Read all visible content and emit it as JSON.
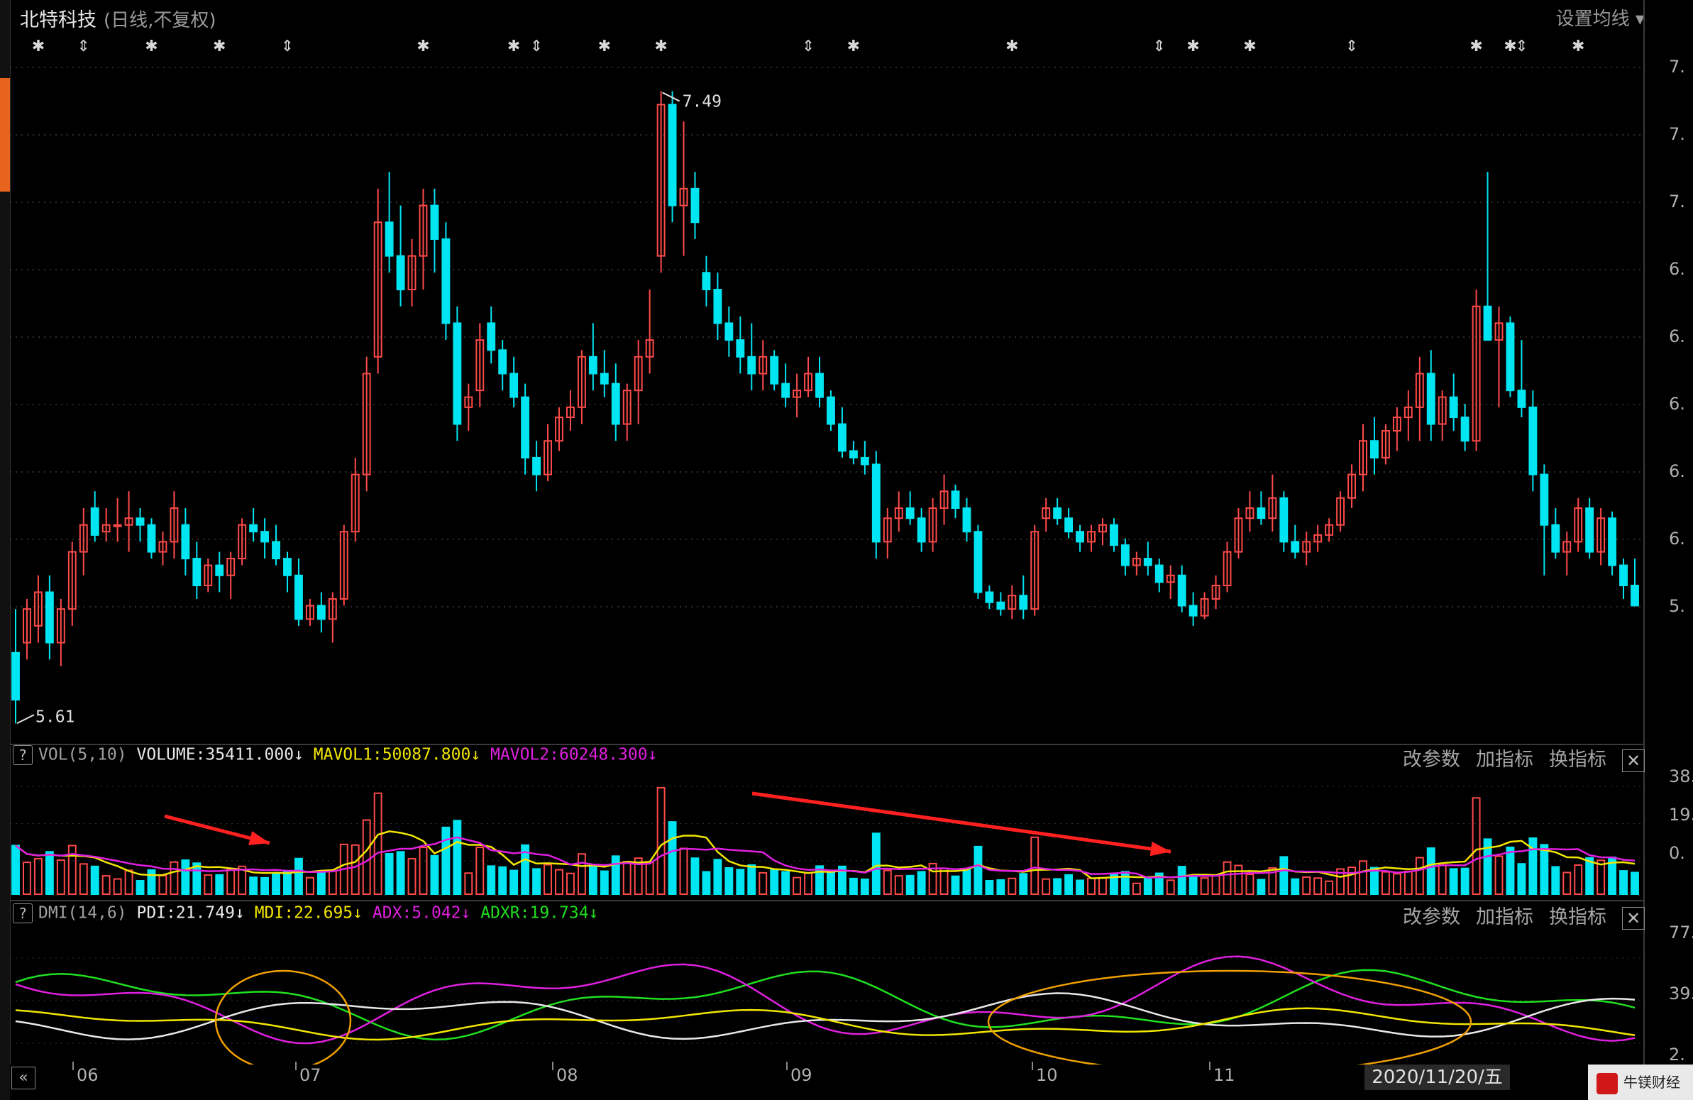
{
  "header": {
    "stock_name": "北特科技",
    "mode": "(日线,不复权)",
    "ma_settings_label": "设置均线 ▾"
  },
  "price_labels": {
    "high": "7.49",
    "low": "5.61"
  },
  "vol_panel": {
    "indicator": "VOL(5,10)",
    "volume_label": "VOLUME:35411.000",
    "mavol1_label": "MAVOL1:50087.800",
    "mavol2_label": "MAVOL2:60248.300",
    "arrow_down": "↓",
    "y_ticks": [
      "38.",
      "19.",
      "0."
    ]
  },
  "dmi_panel": {
    "indicator": "DMI(14,6)",
    "pdi_label": "PDI:21.749",
    "mdi_label": "MDI:22.695",
    "adx_label": "ADX:5.042",
    "adxr_label": "ADXR:19.734",
    "arrow_down": "↓",
    "y_ticks": [
      "77.",
      "39.",
      "2."
    ]
  },
  "panel_buttons": {
    "params": "改参数",
    "add": "加指标",
    "switch": "换指标",
    "close": "✕"
  },
  "price_axis_ticks": [
    "7.",
    "7.",
    "7.",
    "6.",
    "6.",
    "6.",
    "6.",
    "6.",
    "5."
  ],
  "x_axis": {
    "months": [
      "06",
      "07",
      "08",
      "09",
      "10",
      "11"
    ],
    "cursor_date": "2020/11/20/五"
  },
  "nav_button": "«",
  "logo_text": "牛镁财经",
  "colors": {
    "up": "#ff4a4a",
    "down": "#00e5f2",
    "white": "#e8e8e8",
    "yellow": "#f2e600",
    "magenta": "#e020e0",
    "green": "#20e020"
  },
  "chart_data": [
    {
      "type": "candlestick",
      "title": "北特科技",
      "x_months": [
        "06",
        "07",
        "08",
        "09",
        "10",
        "11"
      ],
      "ylim": [
        5.6,
        7.55
      ],
      "annotations": {
        "high": 7.49,
        "low": 5.61
      },
      "ohlc": [
        [
          5.82,
          5.95,
          5.61,
          5.68
        ],
        [
          5.85,
          5.98,
          5.8,
          5.95
        ],
        [
          5.9,
          6.05,
          5.85,
          6.0
        ],
        [
          6.0,
          6.05,
          5.8,
          5.85
        ],
        [
          5.85,
          5.98,
          5.78,
          5.95
        ],
        [
          5.95,
          6.15,
          5.9,
          6.12
        ],
        [
          6.12,
          6.25,
          6.05,
          6.2
        ],
        [
          6.25,
          6.3,
          6.15,
          6.17
        ],
        [
          6.18,
          6.25,
          6.15,
          6.2
        ],
        [
          6.2,
          6.28,
          6.15,
          6.2
        ],
        [
          6.2,
          6.3,
          6.12,
          6.22
        ],
        [
          6.22,
          6.25,
          6.15,
          6.2
        ],
        [
          6.2,
          6.22,
          6.1,
          6.12
        ],
        [
          6.12,
          6.18,
          6.08,
          6.15
        ],
        [
          6.15,
          6.3,
          6.1,
          6.25
        ],
        [
          6.2,
          6.25,
          6.05,
          6.1
        ],
        [
          6.1,
          6.15,
          5.98,
          6.02
        ],
        [
          6.02,
          6.1,
          6.0,
          6.08
        ],
        [
          6.08,
          6.12,
          6.0,
          6.05
        ],
        [
          6.05,
          6.12,
          5.98,
          6.1
        ],
        [
          6.1,
          6.22,
          6.08,
          6.2
        ],
        [
          6.2,
          6.25,
          6.15,
          6.18
        ],
        [
          6.18,
          6.22,
          6.1,
          6.15
        ],
        [
          6.15,
          6.2,
          6.08,
          6.1
        ],
        [
          6.1,
          6.12,
          6.0,
          6.05
        ],
        [
          6.05,
          6.1,
          5.9,
          5.92
        ],
        [
          5.92,
          5.98,
          5.9,
          5.96
        ],
        [
          5.96,
          6.0,
          5.88,
          5.92
        ],
        [
          5.92,
          6.0,
          5.85,
          5.98
        ],
        [
          5.98,
          6.2,
          5.96,
          6.18
        ],
        [
          6.18,
          6.4,
          6.15,
          6.35
        ],
        [
          6.35,
          6.7,
          6.3,
          6.65
        ],
        [
          6.7,
          7.2,
          6.65,
          7.1
        ],
        [
          7.1,
          7.25,
          6.95,
          7.0
        ],
        [
          7.0,
          7.15,
          6.85,
          6.9
        ],
        [
          6.9,
          7.05,
          6.85,
          7.0
        ],
        [
          7.0,
          7.2,
          6.9,
          7.15
        ],
        [
          7.15,
          7.2,
          6.95,
          7.05
        ],
        [
          7.05,
          7.1,
          6.75,
          6.8
        ],
        [
          6.8,
          6.85,
          6.45,
          6.5
        ],
        [
          6.55,
          6.62,
          6.48,
          6.58
        ],
        [
          6.6,
          6.8,
          6.55,
          6.75
        ],
        [
          6.8,
          6.85,
          6.68,
          6.72
        ],
        [
          6.72,
          6.75,
          6.6,
          6.65
        ],
        [
          6.65,
          6.7,
          6.55,
          6.58
        ],
        [
          6.58,
          6.62,
          6.35,
          6.4
        ],
        [
          6.4,
          6.45,
          6.3,
          6.35
        ],
        [
          6.35,
          6.5,
          6.33,
          6.45
        ],
        [
          6.45,
          6.55,
          6.42,
          6.52
        ],
        [
          6.52,
          6.6,
          6.48,
          6.55
        ],
        [
          6.55,
          6.72,
          6.5,
          6.7
        ],
        [
          6.7,
          6.8,
          6.6,
          6.65
        ],
        [
          6.65,
          6.72,
          6.58,
          6.62
        ],
        [
          6.62,
          6.68,
          6.45,
          6.5
        ],
        [
          6.5,
          6.62,
          6.45,
          6.6
        ],
        [
          6.6,
          6.75,
          6.5,
          6.7
        ],
        [
          6.7,
          6.9,
          6.65,
          6.75
        ],
        [
          7.0,
          7.49,
          6.95,
          7.45
        ],
        [
          7.45,
          7.49,
          7.1,
          7.15
        ],
        [
          7.15,
          7.4,
          7.0,
          7.2
        ],
        [
          7.2,
          7.25,
          7.05,
          7.1
        ],
        [
          6.95,
          7.0,
          6.85,
          6.9
        ],
        [
          6.9,
          6.95,
          6.75,
          6.8
        ],
        [
          6.8,
          6.85,
          6.7,
          6.75
        ],
        [
          6.75,
          6.82,
          6.65,
          6.7
        ],
        [
          6.7,
          6.8,
          6.6,
          6.65
        ],
        [
          6.65,
          6.75,
          6.6,
          6.7
        ],
        [
          6.7,
          6.72,
          6.6,
          6.62
        ],
        [
          6.62,
          6.68,
          6.55,
          6.58
        ],
        [
          6.58,
          6.65,
          6.52,
          6.6
        ],
        [
          6.6,
          6.7,
          6.58,
          6.65
        ],
        [
          6.65,
          6.7,
          6.55,
          6.58
        ],
        [
          6.58,
          6.6,
          6.48,
          6.5
        ],
        [
          6.5,
          6.55,
          6.4,
          6.42
        ],
        [
          6.42,
          6.45,
          6.38,
          6.4
        ],
        [
          6.4,
          6.45,
          6.35,
          6.38
        ],
        [
          6.38,
          6.42,
          6.1,
          6.15
        ],
        [
          6.15,
          6.25,
          6.1,
          6.22
        ],
        [
          6.22,
          6.3,
          6.18,
          6.25
        ],
        [
          6.25,
          6.3,
          6.2,
          6.22
        ],
        [
          6.22,
          6.25,
          6.12,
          6.15
        ],
        [
          6.15,
          6.28,
          6.12,
          6.25
        ],
        [
          6.25,
          6.35,
          6.2,
          6.3
        ],
        [
          6.3,
          6.32,
          6.22,
          6.25
        ],
        [
          6.25,
          6.28,
          6.15,
          6.18
        ],
        [
          6.18,
          6.2,
          5.98,
          6.0
        ],
        [
          6.0,
          6.02,
          5.95,
          5.97
        ],
        [
          5.97,
          6.0,
          5.93,
          5.95
        ],
        [
          5.95,
          6.02,
          5.92,
          5.99
        ],
        [
          5.99,
          6.05,
          5.92,
          5.95
        ],
        [
          5.95,
          6.2,
          5.93,
          6.18
        ],
        [
          6.22,
          6.28,
          6.18,
          6.25
        ],
        [
          6.25,
          6.28,
          6.2,
          6.22
        ],
        [
          6.22,
          6.25,
          6.16,
          6.18
        ],
        [
          6.18,
          6.2,
          6.12,
          6.15
        ],
        [
          6.15,
          6.2,
          6.12,
          6.18
        ],
        [
          6.18,
          6.22,
          6.14,
          6.2
        ],
        [
          6.2,
          6.22,
          6.12,
          6.14
        ],
        [
          6.14,
          6.16,
          6.05,
          6.08
        ],
        [
          6.08,
          6.12,
          6.05,
          6.1
        ],
        [
          6.1,
          6.15,
          6.05,
          6.08
        ],
        [
          6.08,
          6.1,
          6.0,
          6.03
        ],
        [
          6.03,
          6.08,
          5.98,
          6.05
        ],
        [
          6.05,
          6.08,
          5.94,
          5.96
        ],
        [
          5.96,
          6.0,
          5.9,
          5.93
        ],
        [
          5.93,
          6.0,
          5.92,
          5.98
        ],
        [
          5.98,
          6.05,
          5.95,
          6.02
        ],
        [
          6.02,
          6.15,
          6.0,
          6.12
        ],
        [
          6.12,
          6.25,
          6.1,
          6.22
        ],
        [
          6.22,
          6.3,
          6.18,
          6.25
        ],
        [
          6.25,
          6.3,
          6.2,
          6.22
        ],
        [
          6.22,
          6.35,
          6.18,
          6.28
        ],
        [
          6.28,
          6.3,
          6.12,
          6.15
        ],
        [
          6.15,
          6.2,
          6.1,
          6.12
        ],
        [
          6.12,
          6.18,
          6.08,
          6.15
        ],
        [
          6.15,
          6.2,
          6.12,
          6.17
        ],
        [
          6.17,
          6.22,
          6.15,
          6.2
        ],
        [
          6.2,
          6.3,
          6.18,
          6.28
        ],
        [
          6.28,
          6.38,
          6.25,
          6.35
        ],
        [
          6.35,
          6.5,
          6.3,
          6.45
        ],
        [
          6.45,
          6.52,
          6.35,
          6.4
        ],
        [
          6.4,
          6.5,
          6.38,
          6.48
        ],
        [
          6.48,
          6.55,
          6.42,
          6.52
        ],
        [
          6.52,
          6.6,
          6.45,
          6.55
        ],
        [
          6.55,
          6.7,
          6.45,
          6.65
        ],
        [
          6.65,
          6.72,
          6.45,
          6.5
        ],
        [
          6.5,
          6.6,
          6.45,
          6.58
        ],
        [
          6.58,
          6.65,
          6.48,
          6.52
        ],
        [
          6.52,
          6.56,
          6.42,
          6.45
        ],
        [
          6.45,
          6.9,
          6.42,
          6.85
        ],
        [
          6.85,
          7.25,
          6.8,
          6.75
        ],
        [
          6.75,
          6.85,
          6.55,
          6.8
        ],
        [
          6.8,
          6.82,
          6.58,
          6.6
        ],
        [
          6.6,
          6.75,
          6.52,
          6.55
        ],
        [
          6.55,
          6.6,
          6.3,
          6.35
        ],
        [
          6.35,
          6.38,
          6.05,
          6.2
        ],
        [
          6.2,
          6.25,
          6.1,
          6.12
        ],
        [
          6.12,
          6.18,
          6.05,
          6.15
        ],
        [
          6.15,
          6.28,
          6.12,
          6.25
        ],
        [
          6.25,
          6.28,
          6.1,
          6.12
        ],
        [
          6.12,
          6.25,
          6.08,
          6.22
        ],
        [
          6.22,
          6.24,
          6.05,
          6.08
        ],
        [
          6.08,
          6.1,
          5.98,
          6.02
        ],
        [
          6.02,
          6.1,
          5.96,
          5.96
        ]
      ]
    },
    {
      "type": "bar",
      "title": "VOL(5,10)",
      "series_values": {
        "VOLUME": 35411.0,
        "MAVOL1": 50087.8,
        "MAVOL2": 60248.3
      },
      "y_ticks": [
        "38.",
        "19.",
        "0."
      ]
    },
    {
      "type": "line",
      "title": "DMI(14,6)",
      "series_values": {
        "PDI": 21.749,
        "MDI": 22.695,
        "ADX": 5.042,
        "ADXR": 19.734
      },
      "y_ticks": [
        "77.",
        "39.",
        "2."
      ]
    }
  ]
}
